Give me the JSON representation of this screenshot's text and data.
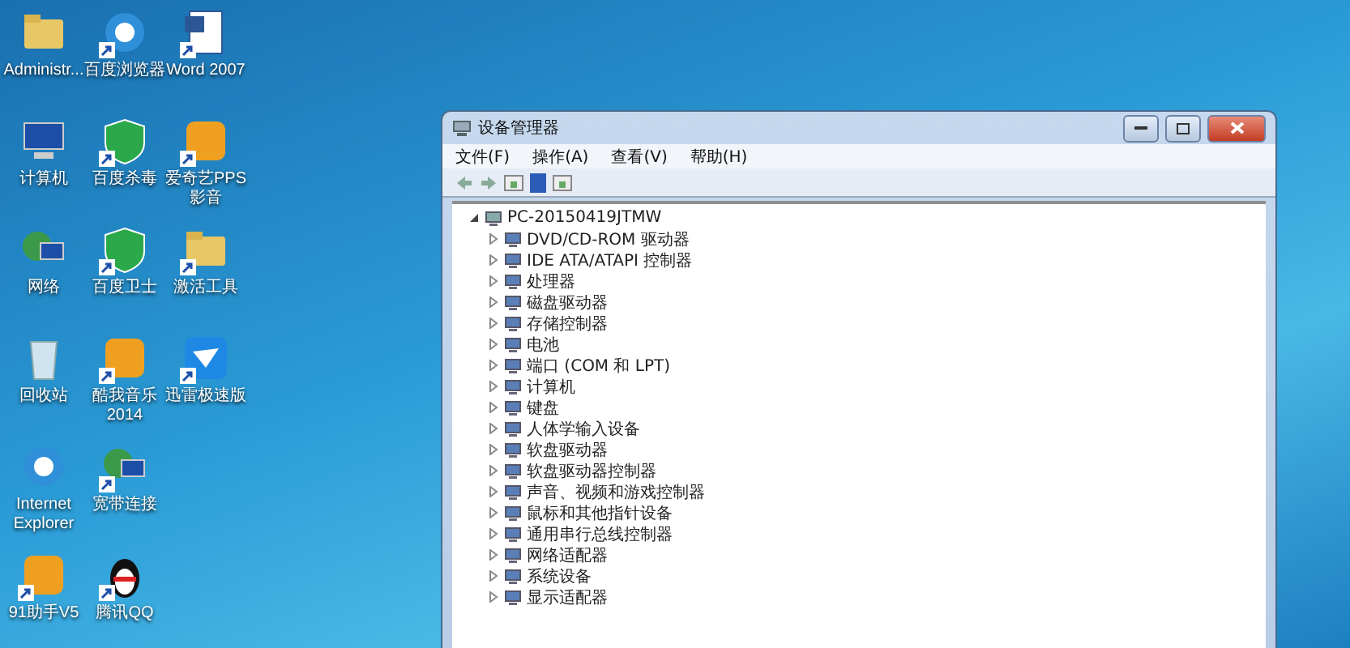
{
  "desktop_icons": [
    {
      "label": "Administr...",
      "kind": "folder",
      "shortcut": false
    },
    {
      "label": "百度浏览器",
      "kind": "browser",
      "shortcut": true
    },
    {
      "label": "Word 2007",
      "kind": "document",
      "shortcut": true
    },
    {
      "label": "计算机",
      "kind": "computer",
      "shortcut": false
    },
    {
      "label": "百度杀毒",
      "kind": "shield",
      "shortcut": true
    },
    {
      "label": "爱奇艺PPS 影音",
      "kind": "app",
      "shortcut": true
    },
    {
      "label": "网络",
      "kind": "network",
      "shortcut": false
    },
    {
      "label": "百度卫士",
      "kind": "shield",
      "shortcut": true
    },
    {
      "label": "激活工具",
      "kind": "folder",
      "shortcut": true
    },
    {
      "label": "回收站",
      "kind": "recycle",
      "shortcut": false
    },
    {
      "label": "酷我音乐 2014",
      "kind": "app",
      "shortcut": true
    },
    {
      "label": "迅雷极速版",
      "kind": "bird",
      "shortcut": true
    },
    {
      "label": "Internet Explorer",
      "kind": "browser",
      "shortcut": false
    },
    {
      "label": "宽带连接",
      "kind": "network",
      "shortcut": true
    },
    {
      "kind": "empty"
    },
    {
      "label": "91助手V5",
      "kind": "app",
      "shortcut": true
    },
    {
      "label": "腾讯QQ",
      "kind": "penguin",
      "shortcut": true
    }
  ],
  "window": {
    "title": "设备管理器",
    "menu": [
      "文件(F)",
      "操作(A)",
      "查看(V)",
      "帮助(H)"
    ],
    "tree": {
      "label": "PC-20150419JTMW",
      "expanded": true,
      "children": [
        {
          "label": "DVD/CD-ROM 驱动器",
          "expanded": false
        },
        {
          "label": "IDE ATA/ATAPI 控制器",
          "expanded": false
        },
        {
          "label": "处理器",
          "expanded": false
        },
        {
          "label": "磁盘驱动器",
          "expanded": false
        },
        {
          "label": "存储控制器",
          "expanded": false
        },
        {
          "label": "电池",
          "expanded": false
        },
        {
          "label": "端口 (COM 和 LPT)",
          "expanded": false
        },
        {
          "label": "计算机",
          "expanded": false
        },
        {
          "label": "键盘",
          "expanded": false
        },
        {
          "label": "人体学输入设备",
          "expanded": false
        },
        {
          "label": "软盘驱动器",
          "expanded": false
        },
        {
          "label": "软盘驱动器控制器",
          "expanded": false
        },
        {
          "label": "声音、视频和游戏控制器",
          "expanded": false
        },
        {
          "label": "鼠标和其他指针设备",
          "expanded": false
        },
        {
          "label": "通用串行总线控制器",
          "expanded": false
        },
        {
          "label": "网络适配器",
          "expanded": false
        },
        {
          "label": "系统设备",
          "expanded": false
        },
        {
          "label": "显示适配器",
          "expanded": false
        }
      ]
    }
  }
}
